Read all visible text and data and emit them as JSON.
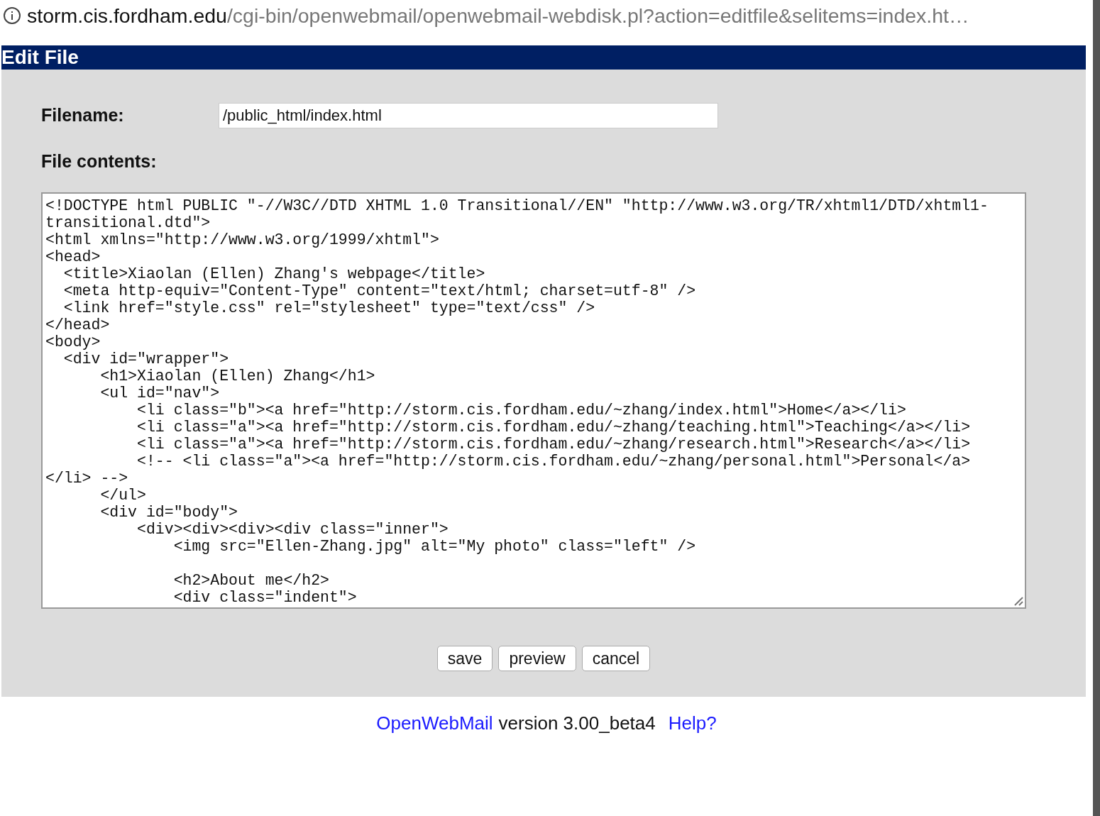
{
  "address_bar": {
    "host": "storm.cis.fordham.edu",
    "path": "/cgi-bin/openwebmail/openwebmail-webdisk.pl?action=editfile&selitems=index.ht…"
  },
  "header": {
    "title": "Edit File"
  },
  "form": {
    "filename_label": "Filename:",
    "filename_value": "/public_html/index.html",
    "contents_label": "File contents:",
    "contents_lines": [
      "<!DOCTYPE html PUBLIC \"-//W3C//DTD XHTML 1.0 Transitional//EN\" \"http://www.w3.org/TR/xhtml1/DTD/xhtml1-",
      "transitional.dtd\">",
      "<html xmlns=\"http://www.w3.org/1999/xhtml\">",
      "<head>",
      "  <title>Xiaolan (Ellen) Zhang's webpage</title>",
      "  <meta http-equiv=\"Content-Type\" content=\"text/html; charset=utf-8\" />",
      "  <link href=\"style.css\" rel=\"stylesheet\" type=\"text/css\" />",
      "</head>",
      "<body>",
      "  <div id=\"wrapper\">",
      "      <h1>Xiaolan (Ellen) Zhang</h1>",
      "      <ul id=\"nav\">",
      "          <li class=\"b\"><a href=\"http://storm.cis.fordham.edu/~zhang/index.html\">Home</a></li>",
      "          <li class=\"a\"><a href=\"http://storm.cis.fordham.edu/~zhang/teaching.html\">Teaching</a></li>",
      "          <li class=\"a\"><a href=\"http://storm.cis.fordham.edu/~zhang/research.html\">Research</a></li>",
      "          <!-- <li class=\"a\"><a href=\"http://storm.cis.fordham.edu/~zhang/personal.html\">Personal</a>",
      "</li> -->",
      "      </ul>",
      "      <div id=\"body\">",
      "          <div><div><div><div class=\"inner\">",
      "              <img src=\"Ellen-Zhang.jpg\" alt=\"My photo\" class=\"left\" />",
      {
        "text": "              <h2>About me</h2>",
        "blank_before": true
      },
      "              <div class=\"indent\">"
    ],
    "buttons": [
      "save",
      "preview",
      "cancel"
    ]
  },
  "footer": {
    "link": "OpenWebMail",
    "version": "version 3.00_beta4",
    "help": "Help?"
  }
}
